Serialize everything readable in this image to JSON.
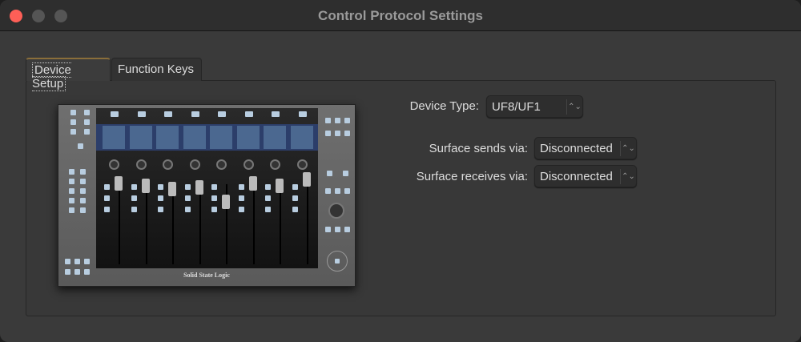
{
  "window": {
    "title": "Control Protocol Settings"
  },
  "tabs": [
    {
      "label": "Device Setup",
      "active": true
    },
    {
      "label": "Function Keys",
      "active": false
    }
  ],
  "device_type": {
    "label": "Device Type:",
    "value": "UF8/UF1"
  },
  "sends": {
    "label": "Surface sends via:",
    "value": "Disconnected"
  },
  "receives": {
    "label": "Surface receives via:",
    "value": "Disconnected"
  },
  "device_image": {
    "logo": "Solid State Logic",
    "channels": 8
  },
  "colors": {
    "close": "#fe5f57",
    "inactive_light": "#555555",
    "accent": "#8a6e3a"
  }
}
